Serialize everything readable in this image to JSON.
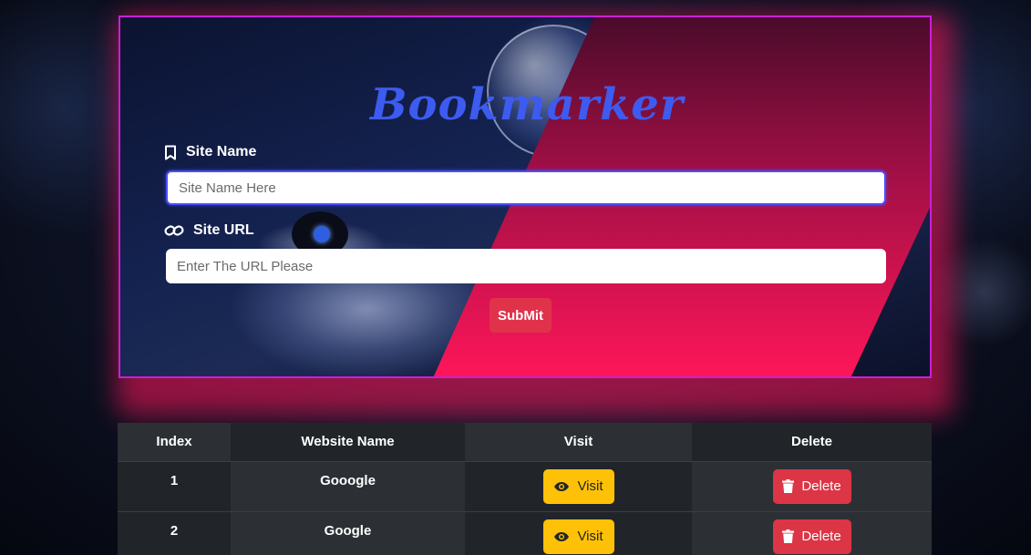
{
  "app": {
    "title": "Bookmarker"
  },
  "form": {
    "site_name_label": "Site Name",
    "site_name_placeholder": "Site Name Here",
    "site_url_label": "Site URL",
    "site_url_placeholder": "Enter The URL Please",
    "submit_label": "SubMit",
    "icons": {
      "site_name": "bookmark-icon",
      "site_url": "link-icon"
    }
  },
  "table": {
    "headers": [
      "Index",
      "Website Name",
      "Visit",
      "Delete"
    ],
    "rows": [
      {
        "index": "1",
        "name": "Gooogle",
        "visit_label": "Visit",
        "delete_label": "Delete"
      },
      {
        "index": "2",
        "name": "Google",
        "visit_label": "Visit",
        "delete_label": "Delete"
      }
    ],
    "icons": {
      "visit": "eye-icon",
      "delete": "trash-icon"
    }
  },
  "colors": {
    "title": "#3d5bf0",
    "card_border": "#c81fd9",
    "glow": "#ff1659",
    "visit_button": "#ffc107",
    "delete_button": "#dc3545",
    "submit_button": "#e0334b",
    "table_dark": "#212529",
    "table_mid": "#2c3035"
  }
}
